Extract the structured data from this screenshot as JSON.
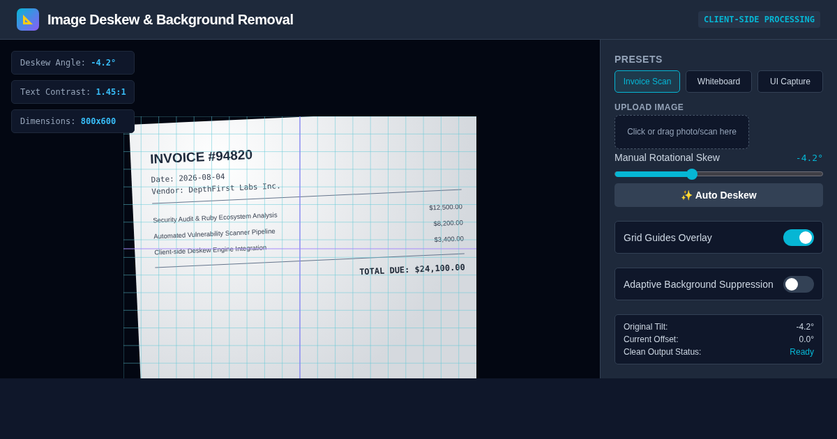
{
  "header": {
    "title": "Image Deskew & Background Removal",
    "badge": "CLIENT-SIDE PROCESSING"
  },
  "stats": [
    {
      "label": "Deskew Angle:",
      "value": "-4.2°"
    },
    {
      "label": "Text Contrast:",
      "value": "1.45:1"
    },
    {
      "label": "Dimensions:",
      "value": "800x600"
    }
  ],
  "document": {
    "title": "INVOICE #94820",
    "date": "Date: 2026-08-04",
    "vendor": "Vendor: DepthFirst Labs Inc.",
    "items": [
      {
        "description": "Security Audit & Ruby Ecosystem Analysis",
        "amount": "$12,500.00"
      },
      {
        "description": "Automated Vulnerability Scanner Pipeline",
        "amount": "$8,200.00"
      },
      {
        "description": "Client-side Deskew Engine Integration",
        "amount": "$3,400.00"
      }
    ],
    "total": "TOTAL DUE: $24,100.00"
  },
  "panel": {
    "presets_heading": "PRESETS",
    "presets": [
      {
        "label": "Invoice Scan",
        "selected": true
      },
      {
        "label": "Whiteboard",
        "selected": false
      },
      {
        "label": "UI Capture",
        "selected": false
      }
    ],
    "upload_heading": "UPLOAD IMAGE",
    "upload_placeholder": "Click or drag photo/scan here",
    "skew": {
      "label": "Manual Rotational Skew",
      "reading": "-4.2°",
      "level": 0.37
    },
    "auto_button": "✨ Auto Deskew",
    "toggles": [
      {
        "label": "Grid Guides Overlay",
        "on": true
      },
      {
        "label": "Adaptive Background Suppression",
        "on": false
      }
    ],
    "info": [
      {
        "label": "Original Tilt:",
        "value": "-4.2°",
        "kind": "plain"
      },
      {
        "label": "Current Offset:",
        "value": "0.0°",
        "kind": "plain"
      },
      {
        "label": "Clean Output Status:",
        "value": "Ready",
        "kind": "status"
      }
    ]
  }
}
